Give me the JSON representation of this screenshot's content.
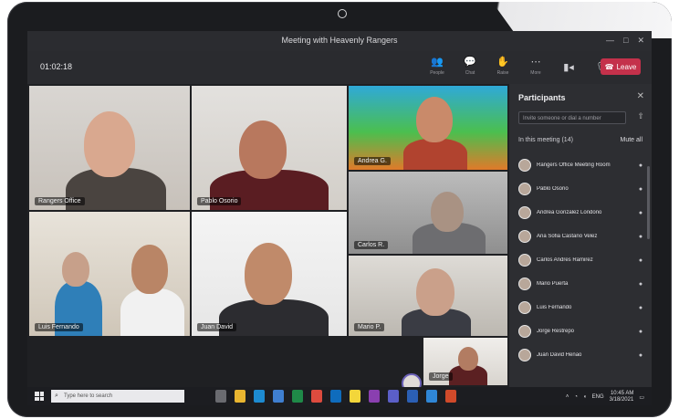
{
  "meeting": {
    "title": "Meeting with Heavenly Rangers",
    "timer": "01:02:18",
    "toolbar": [
      {
        "icon": "people-icon",
        "label": "People"
      },
      {
        "icon": "chat-icon",
        "label": "Chat"
      },
      {
        "icon": "raise-hand-icon",
        "label": "Raise"
      },
      {
        "icon": "more-icon",
        "label": "More"
      }
    ],
    "hangup_label": "Leave"
  },
  "window": {
    "minimize": "—",
    "maximize": "□",
    "close": "✕"
  },
  "tiles": [
    {
      "name": "Rangers Office"
    },
    {
      "name": "Pablo Osorio"
    },
    {
      "name": "Andrea G."
    },
    {
      "name": "Carlos R."
    },
    {
      "name": "Luis Fernando"
    },
    {
      "name": "Juan David"
    },
    {
      "name": "Mario P."
    },
    {
      "name": "Jorge"
    }
  ],
  "participants_panel": {
    "title": "Participants",
    "invite_placeholder": "Invite someone or dial a number",
    "section_label": "In this meeting (14)",
    "mute_all": "Mute all",
    "people": [
      {
        "name": "Rangers Office Meeting Room"
      },
      {
        "name": "Pablo Osorio"
      },
      {
        "name": "Andrea Gonzalez Londono"
      },
      {
        "name": "Ana Sofia Castaño Velez"
      },
      {
        "name": "Carlos Andres Ramirez"
      },
      {
        "name": "Mario Puerta"
      },
      {
        "name": "Luis Fernando"
      },
      {
        "name": "Jorge Restrepo"
      },
      {
        "name": "Juan David Henao"
      }
    ]
  },
  "taskbar": {
    "search_placeholder": "Type here to search",
    "time": "10:45 AM",
    "date": "3/18/2021",
    "language": "ENG"
  }
}
